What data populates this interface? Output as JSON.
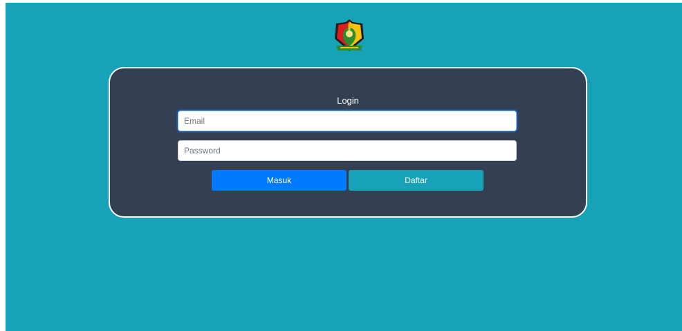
{
  "theme": {
    "background": "#17a2b8",
    "card": "#343f52",
    "primary_button": "#007bff",
    "secondary_button": "#17a2b8"
  },
  "logo": {
    "icon": "regional-emblem-shield-icon"
  },
  "login": {
    "title": "Login",
    "email": {
      "placeholder": "Email",
      "value": ""
    },
    "password": {
      "placeholder": "Password",
      "value": ""
    },
    "submit_label": "Masuk",
    "register_label": "Daftar"
  }
}
